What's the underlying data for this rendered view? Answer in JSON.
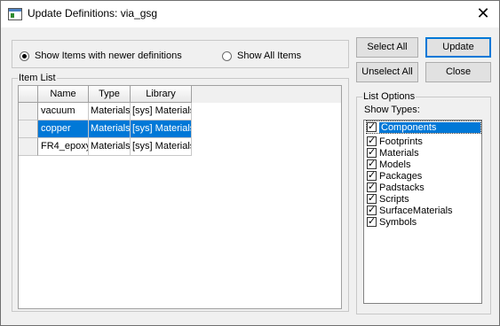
{
  "window": {
    "title": "Update Definitions: via_gsg",
    "close_glyph": "✕"
  },
  "filter": {
    "option_newer": "Show Items with newer definitions",
    "option_all": "Show All Items",
    "selected": "newer"
  },
  "item_list": {
    "label": "Item List",
    "columns": [
      "Name",
      "Type",
      "Library"
    ],
    "rows": [
      {
        "name": "vacuum",
        "type": "Materials",
        "library": "[sys] Materials",
        "selected": false
      },
      {
        "name": "copper",
        "type": "Materials",
        "library": "[sys] Materials",
        "selected": true
      },
      {
        "name": "FR4_epoxy",
        "type": "Materials",
        "library": "[sys] Materials",
        "selected": false
      }
    ]
  },
  "buttons": {
    "select_all": "Select All",
    "unselect_all": "Unselect All",
    "update": "Update",
    "close": "Close"
  },
  "list_options": {
    "label": "List Options",
    "show_types_label": "Show Types:",
    "types": [
      {
        "label": "Components",
        "checked": true,
        "highlight": true
      },
      {
        "label": "Footprints",
        "checked": true
      },
      {
        "label": "Materials",
        "checked": true
      },
      {
        "label": "Models",
        "checked": true
      },
      {
        "label": "Packages",
        "checked": true
      },
      {
        "label": "Padstacks",
        "checked": true
      },
      {
        "label": "Scripts",
        "checked": true
      },
      {
        "label": "SurfaceMaterials",
        "checked": true
      },
      {
        "label": "Symbols",
        "checked": true
      }
    ]
  },
  "colors": {
    "selection": "#0078d7",
    "background": "#f0f0f0"
  }
}
